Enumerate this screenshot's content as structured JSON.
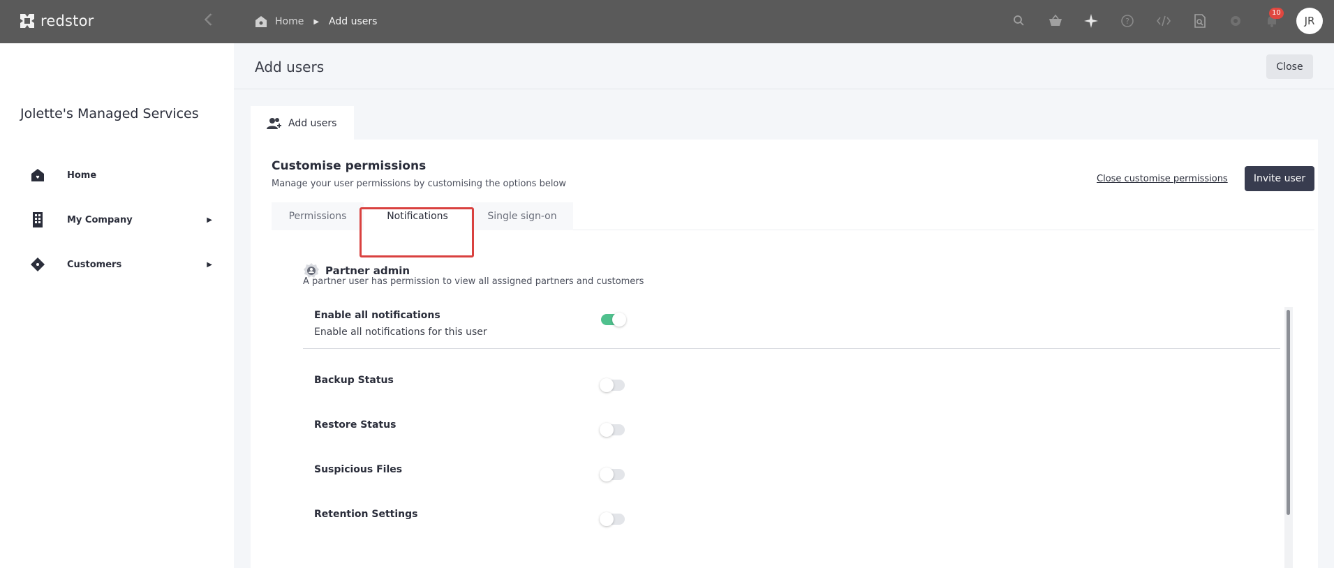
{
  "brand": {
    "name": "redstor"
  },
  "breadcrumb": {
    "home": "Home",
    "current": "Add users"
  },
  "topbar": {
    "icons": [
      "search-icon",
      "basket-icon",
      "sparkle-icon",
      "help-icon",
      "code-icon",
      "doc-search-icon",
      "gear-icon",
      "bell-icon"
    ],
    "notification_count": "10",
    "avatar_initials": "JR"
  },
  "sidebar": {
    "org_name": "Jolette's Managed Services",
    "items": [
      {
        "label": "Home",
        "icon": "home-icon",
        "expandable": false
      },
      {
        "label": "My Company",
        "icon": "building-icon",
        "expandable": true
      },
      {
        "label": "Customers",
        "icon": "customers-icon",
        "expandable": true
      }
    ]
  },
  "page": {
    "title": "Add users",
    "close_label": "Close",
    "outer_tab": "Add users"
  },
  "permissions_panel": {
    "title": "Customise permissions",
    "subtitle": "Manage your user permissions by customising the options below",
    "close_link": "Close customise permissions",
    "invite_label": "Invite user",
    "tabs": [
      {
        "label": "Permissions",
        "active": false
      },
      {
        "label": "Notifications",
        "active": true
      },
      {
        "label": "Single sign-on",
        "active": false
      }
    ],
    "role": {
      "title": "Partner admin",
      "description": "A partner user has permission to view all assigned partners and customers"
    },
    "notifications": [
      {
        "label": "Enable all notifications",
        "sublabel": "Enable all notifications for this user",
        "enabled": true
      },
      {
        "label": "Backup Status",
        "enabled": false
      },
      {
        "label": "Restore Status",
        "enabled": false
      },
      {
        "label": "Suspicious Files",
        "enabled": false
      },
      {
        "label": "Retention Settings",
        "enabled": false
      }
    ]
  },
  "colors": {
    "topbar": "#5a5a5a",
    "accent_dark": "#383c4f",
    "toggle_on": "#4fc08d",
    "highlight": "#d9413f",
    "badge": "#e0473f"
  }
}
